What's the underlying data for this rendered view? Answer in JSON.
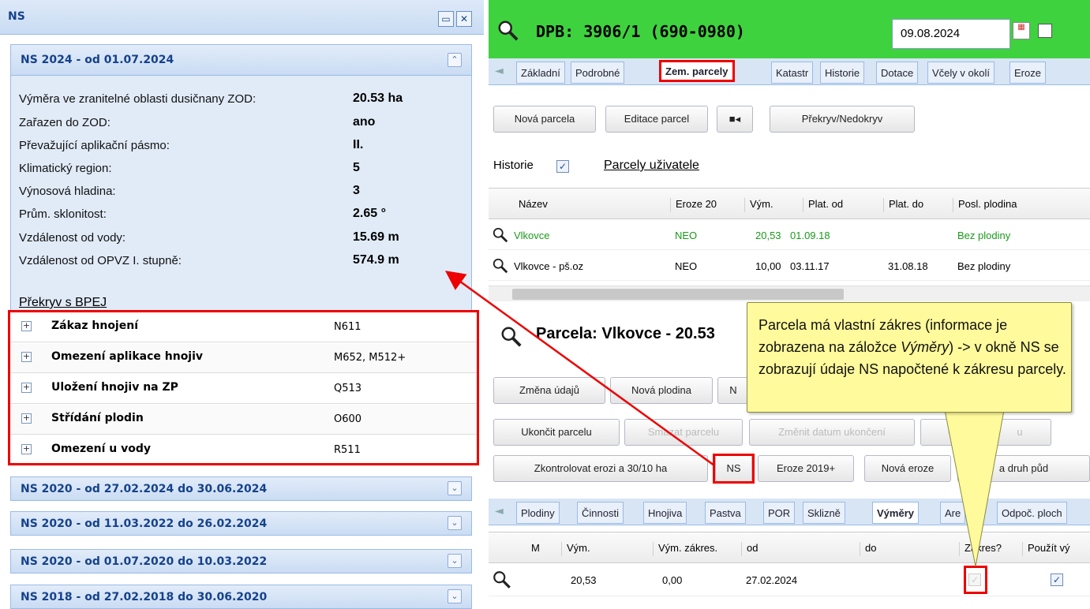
{
  "ns_panel": {
    "title": "NS",
    "open_section": {
      "title": "NS 2024 - od 01.07.2024",
      "rows": [
        {
          "label": "Výměra ve zranitelné oblasti dusičnany ZOD:",
          "value": "20.53 ha"
        },
        {
          "label": "Zařazen do ZOD:",
          "value": "ano"
        },
        {
          "label": "Převažující aplikační pásmo:",
          "value": "II."
        },
        {
          "label": "Klimatický region:",
          "value": "5"
        },
        {
          "label": "Výnosová hladina:",
          "value": "3"
        },
        {
          "label": "Prům. sklonitost:",
          "value": "2.65 °"
        },
        {
          "label": "Vzdálenost od vody:",
          "value": "15.69 m"
        },
        {
          "label": "Vzdálenost od OPVZ I. stupně:",
          "value": "574.9 m"
        }
      ],
      "bpej_link": "Překryv s BPEJ",
      "bpej_rows": [
        {
          "name": "Zákaz hnojení",
          "code": "N611"
        },
        {
          "name": "Omezení aplikace hnojiv",
          "code": "M652, M512+"
        },
        {
          "name": "Uložení hnojiv na ZP",
          "code": "Q513"
        },
        {
          "name": "Střídání plodin",
          "code": "O600"
        },
        {
          "name": "Omezení u vody",
          "code": "R511"
        }
      ]
    },
    "collapsed_sections": [
      "NS 2020 - od 27.02.2024 do 30.06.2024",
      "NS 2020 - od 11.03.2022 do 26.02.2024",
      "NS 2020 - od 01.07.2020 do 10.03.2022",
      "NS 2018 - od 27.02.2018 do 30.06.2020"
    ]
  },
  "dpb": {
    "title": "DPB: 3906/1 (690-0980)",
    "date": "09.08.2024",
    "tabs": [
      "Základní",
      "Podrobné",
      "Zem. parcely",
      "Katastr",
      "Historie",
      "Dotace",
      "Včely v okolí",
      "Eroze"
    ],
    "active_tab": "Zem. parcely",
    "toolbar": {
      "new": "Nová parcela",
      "edit": "Editace parcel",
      "overlap": "Překryv/Nedokryv"
    },
    "history_label": "Historie",
    "parcels_link": "Parcely uživatele",
    "grid_headers": [
      "Název",
      "Eroze 20",
      "Vým.",
      "Plat. od",
      "Plat. do",
      "Posl. plodina"
    ],
    "grid_rows": [
      {
        "name": "Vlkovce",
        "eroze": "NEO",
        "vym": "20,53",
        "od": "01.09.18",
        "do": "",
        "plodina": "Bez plodiny"
      },
      {
        "name": "Vlkovce - pš.oz",
        "eroze": "NEO",
        "vym": "10,00",
        "od": "03.11.17",
        "do": "31.08.18",
        "plodina": "Bez plodiny"
      }
    ]
  },
  "parcela": {
    "title": "Parcela: Vlkovce - 20.53",
    "row1": [
      "Změna údajů",
      "Nová plodina",
      "N"
    ],
    "row2": [
      "Ukončit parcelu",
      "Smazat parcelu",
      "Změnit datum ukončení",
      "O",
      "u"
    ],
    "row3": [
      "Zkontrolovat erozi a 30/10 ha",
      "NS",
      "Eroze 2019+",
      "Nová eroze",
      "a druh půd"
    ],
    "tabs": [
      "Plodiny",
      "Činnosti",
      "Hnojiva",
      "Pastva",
      "POR",
      "Sklizně",
      "Výměry",
      "Are",
      "Odpoč. ploch"
    ],
    "active_tab": "Výměry",
    "grid_headers": [
      "M",
      "Vým.",
      "Vým. zákres.",
      "od",
      "do",
      "Zákres?",
      "Použít vý"
    ],
    "grid_row": {
      "vym": "20,53",
      "vym_zakres": "0,00",
      "od": "27.02.2024",
      "do": ""
    }
  },
  "callout": {
    "text_before": "Parcela má vlastní zákres (informace je zobrazena na záložce ",
    "text_italic": "Výměry",
    "text_after": ") -> v okně NS se zobrazují údaje NS napočtené k zákresu parcely."
  },
  "colors": {
    "header_green": "#3fd23f",
    "highlight_red": "#e00000",
    "callout_yellow": "#fffa9c",
    "panel_blue": "#e1ebf8"
  }
}
